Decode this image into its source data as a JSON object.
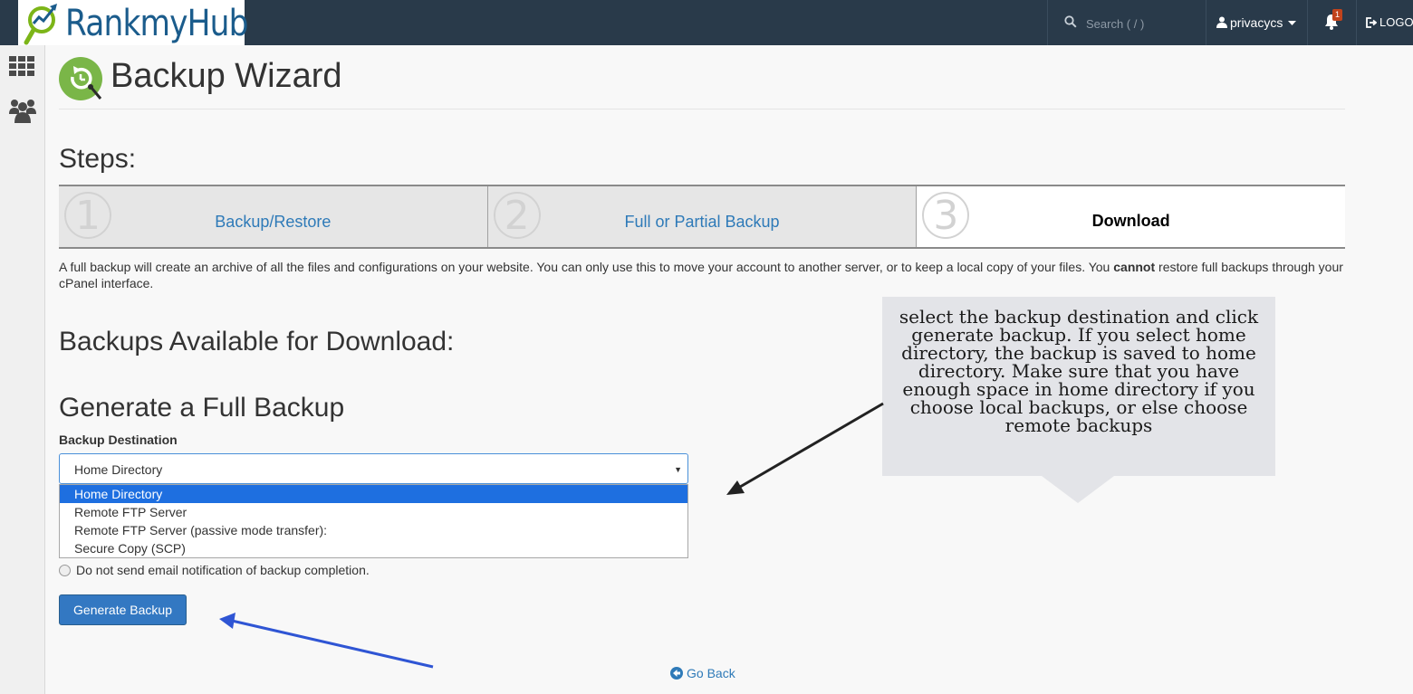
{
  "brand": {
    "name": "RankmyHub"
  },
  "navbar": {
    "search_placeholder": "Search ( / )",
    "username": "privacycs",
    "notification_count": "1",
    "logout_label": "LOGOUT"
  },
  "page": {
    "title": "Backup Wizard"
  },
  "steps": {
    "heading": "Steps:",
    "items": [
      {
        "number": "1",
        "label": "Backup/Restore"
      },
      {
        "number": "2",
        "label": "Full or Partial Backup"
      },
      {
        "number": "3",
        "label": "Download"
      }
    ]
  },
  "description": {
    "part1": "A full backup will create an archive of all the files and configurations on your website. You can only use this to move your account to another server, or to keep a local copy of your files. You ",
    "emphasis": "cannot",
    "part2": " restore full backups through your cPanel interface."
  },
  "sections": {
    "available_heading": "Backups Available for Download:",
    "generate_heading": "Generate a Full Backup"
  },
  "form": {
    "destination_label": "Backup Destination",
    "selected_value": "Home Directory",
    "options": [
      "Home Directory",
      "Remote FTP Server",
      "Remote FTP Server (passive mode transfer):",
      "Secure Copy (SCP)"
    ],
    "notify_label": "Do not send email notification of backup completion.",
    "generate_button": "Generate Backup"
  },
  "footer_link": {
    "go_back": "Go Back"
  },
  "annotation": {
    "text": "select the backup destination and click generate backup. If you select home directory, the backup is saved to home directory. Make sure that you have enough space in home directory if you choose local backups, or else choose remote backups"
  },
  "icons": {
    "search": "search-icon",
    "user": "user-icon",
    "bell": "bell-icon",
    "logout": "logout-icon",
    "grid": "grid-icon",
    "users": "users-icon",
    "back": "arrow-circle-left-icon"
  },
  "colors": {
    "navbar": "#293a4a",
    "link": "#2e7ab8",
    "button": "#3378c2",
    "dropdown_highlight": "#1e6fe0",
    "badge": "#c1431c",
    "callout": "#e3e4e8"
  }
}
